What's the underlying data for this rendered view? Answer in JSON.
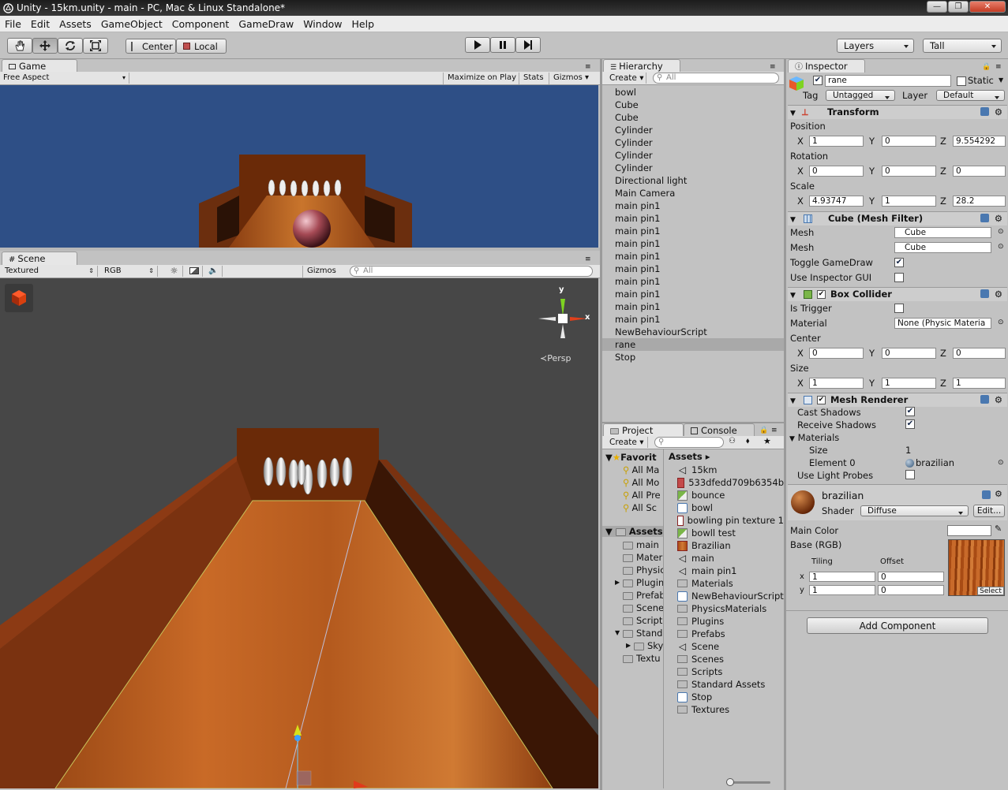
{
  "window": {
    "title": "Unity - 15km.unity - main - PC, Mac & Linux Standalone*"
  },
  "menu": [
    "File",
    "Edit",
    "Assets",
    "GameObject",
    "Component",
    "GameDraw",
    "Window",
    "Help"
  ],
  "toolbar": {
    "center": "Center",
    "local": "Local",
    "layers": "Layers",
    "layout": "Tall"
  },
  "game": {
    "tab": "Game",
    "aspect": "Free Aspect",
    "maximize": "Maximize on Play",
    "stats": "Stats",
    "gizmos": "Gizmos"
  },
  "scene": {
    "tab": "Scene",
    "render_mode": "Textured",
    "color_mode": "RGB",
    "gizmos": "Gizmos",
    "search_placeholder": "All",
    "persp": "Persp",
    "axis_y": "y",
    "axis_x": "x"
  },
  "hierarchy": {
    "tab": "Hierarchy",
    "create": "Create",
    "search_placeholder": "All",
    "selected_index": 20,
    "items": [
      "bowl",
      "Cube",
      "Cube",
      "Cylinder",
      "Cylinder",
      "Cylinder",
      "Cylinder",
      "Directional light",
      "Main Camera",
      "main pin1",
      "main pin1",
      "main pin1",
      "main pin1",
      "main pin1",
      "main pin1",
      "main pin1",
      "main pin1",
      "main pin1",
      "main pin1",
      "NewBehaviourScript",
      "rane",
      "Stop"
    ]
  },
  "project": {
    "tab": "Project",
    "console_tab": "Console",
    "create": "Create",
    "favorites_label": "Favorit",
    "favorites": [
      "All Ma",
      "All Mo",
      "All Pre",
      "All Sc"
    ],
    "assets_label": "Assets",
    "tree": [
      "main",
      "Mater",
      "Physic",
      "Plugin",
      "Prefab",
      "Scene",
      "Script",
      "Stand",
      "Sky",
      "Textu"
    ],
    "breadcrumb": "Assets",
    "assets": [
      {
        "name": "15km",
        "icon": "unity-scene-icon"
      },
      {
        "name": "533dfedd709b6354b",
        "icon": "texture-icon"
      },
      {
        "name": "bounce",
        "icon": "physic-material-icon"
      },
      {
        "name": "bowl",
        "icon": "script-icon"
      },
      {
        "name": "bowling pin texture 1",
        "icon": "texture-icon"
      },
      {
        "name": "bowll test",
        "icon": "physic-material-icon"
      },
      {
        "name": "Brazilian",
        "icon": "texture-icon"
      },
      {
        "name": "main",
        "icon": "unity-scene-icon"
      },
      {
        "name": "main pin1",
        "icon": "prefab-icon"
      },
      {
        "name": "Materials",
        "icon": "folder-icon"
      },
      {
        "name": "NewBehaviourScript",
        "icon": "script-icon"
      },
      {
        "name": "PhysicsMaterials",
        "icon": "folder-icon"
      },
      {
        "name": "Plugins",
        "icon": "folder-icon"
      },
      {
        "name": "Prefabs",
        "icon": "folder-icon"
      },
      {
        "name": "Scene",
        "icon": "unity-scene-icon"
      },
      {
        "name": "Scenes",
        "icon": "folder-icon"
      },
      {
        "name": "Scripts",
        "icon": "folder-icon"
      },
      {
        "name": "Standard Assets",
        "icon": "folder-icon"
      },
      {
        "name": "Stop",
        "icon": "script-icon"
      },
      {
        "name": "Textures",
        "icon": "folder-icon"
      }
    ]
  },
  "inspector": {
    "tab": "Inspector",
    "object_name": "rane",
    "static_label": "Static",
    "tag_label": "Tag",
    "tag_value": "Untagged",
    "layer_label": "Layer",
    "layer_value": "Default",
    "transform": {
      "title": "Transform",
      "position_label": "Position",
      "position": {
        "x": "1",
        "y": "0",
        "z": "9.554292"
      },
      "rotation_label": "Rotation",
      "rotation": {
        "x": "0",
        "y": "0",
        "z": "0"
      },
      "scale_label": "Scale",
      "scale": {
        "x": "4.93747",
        "y": "1",
        "z": "28.2"
      }
    },
    "mesh_filter": {
      "title": "Cube (Mesh Filter)",
      "mesh_label": "Mesh",
      "mesh_value": "Cube",
      "toggle_gamedraw": "Toggle GameDraw",
      "use_inspector_gui": "Use Inspector GUI"
    },
    "box_collider": {
      "title": "Box Collider",
      "is_trigger": "Is Trigger",
      "material_label": "Material",
      "material_value": "None (Physic Materia",
      "center_label": "Center",
      "center": {
        "x": "0",
        "y": "0",
        "z": "0"
      },
      "size_label": "Size",
      "size": {
        "x": "1",
        "y": "1",
        "z": "1"
      }
    },
    "mesh_renderer": {
      "title": "Mesh Renderer",
      "cast_shadows": "Cast Shadows",
      "receive_shadows": "Receive Shadows",
      "materials_label": "Materials",
      "size_label": "Size",
      "size_value": "1",
      "element0_label": "Element 0",
      "element0_value": "brazilian",
      "use_light_probes": "Use Light Probes"
    },
    "material": {
      "name": "brazilian",
      "shader_label": "Shader",
      "shader_value": "Diffuse",
      "edit": "Edit...",
      "main_color": "Main Color",
      "base_rgb": "Base (RGB)",
      "tiling": "Tiling",
      "offset": "Offset",
      "x_label": "x",
      "y_label": "y",
      "tiling_x": "1",
      "tiling_y": "1",
      "offset_x": "0",
      "offset_y": "0",
      "select": "Select"
    },
    "add_component": "Add Component"
  },
  "axis_letters": {
    "x": "X",
    "y": "Y",
    "z": "Z"
  },
  "colors": {
    "game_sky": "#2e4f86",
    "scene_bg": "#474747",
    "selection": "#a9a9a9",
    "wood": "#b8581d"
  }
}
